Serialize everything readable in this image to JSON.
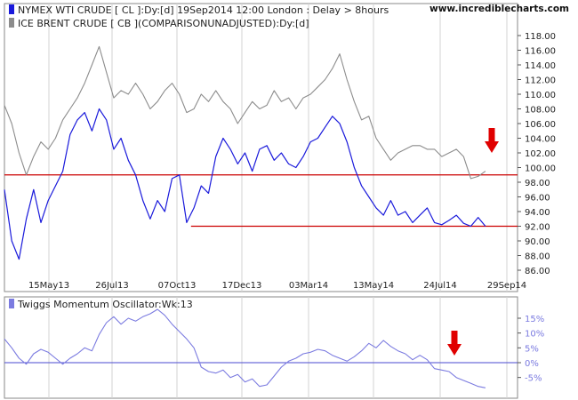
{
  "brand": "www.incrediblecharts.com",
  "colors": {
    "wti": "#1a1adb",
    "brent": "#8c8c8c",
    "support": "#cc0000",
    "osc": "#7b7be0",
    "zero": "#4a4ad0",
    "arrow": "#e00000",
    "grid": "#d3d3d3",
    "frame": "#8a8a8a"
  },
  "chart_data": [
    {
      "type": "line",
      "legend": [
        {
          "label": "NYMEX WTI CRUDE [ CL ]:Dy:[d]  19Sep2014 12:00 London : Delay > 8hours",
          "color_key": "wti"
        },
        {
          "label": "ICE BRENT CRUDE [ CB ](COMPARISONUNADJUSTED):Dy:[d]",
          "color_key": "brent"
        }
      ],
      "x_ticks": [
        "15May13",
        "26Jul13",
        "07Oct13",
        "17Dec13",
        "03Mar14",
        "13May14",
        "24Jul14",
        "29Sep14"
      ],
      "y_ticks": [
        "86.00",
        "88.00",
        "90.00",
        "92.00",
        "94.00",
        "96.00",
        "98.00",
        "100.00",
        "102.00",
        "104.00",
        "106.00",
        "108.00",
        "110.00",
        "112.00",
        "114.00",
        "116.00",
        "118.00"
      ],
      "ylim": [
        84.4,
        119.8
      ],
      "x_index_range": [
        0,
        352
      ],
      "horizontal_lines": [
        {
          "value": 99.0,
          "x_from": 0,
          "x_to": 352
        },
        {
          "value": 92.0,
          "x_from": 128,
          "x_to": 352
        }
      ],
      "annotation": "down-arrow at 26Sep14",
      "series": [
        {
          "color_key": "wti",
          "x": [
            0,
            5,
            10,
            15,
            20,
            25,
            30,
            35,
            40,
            45,
            50,
            55,
            60,
            65,
            70,
            75,
            80,
            85,
            90,
            95,
            100,
            105,
            110,
            115,
            120,
            125,
            130,
            135,
            140,
            145,
            150,
            155,
            160,
            165,
            170,
            175,
            180,
            185,
            190,
            195,
            200,
            205,
            210,
            215,
            220,
            225,
            230,
            235,
            240,
            245,
            250,
            255,
            260,
            265,
            270,
            275,
            280,
            285,
            290,
            295,
            300,
            305,
            310,
            315,
            320,
            325,
            330
          ],
          "values": [
            97.0,
            90.0,
            87.5,
            93.0,
            97.0,
            92.5,
            95.5,
            97.5,
            99.5,
            104.5,
            106.5,
            107.5,
            105.0,
            108.0,
            106.5,
            102.5,
            104.0,
            101.0,
            99.0,
            95.5,
            93.0,
            95.5,
            94.0,
            98.5,
            99.0,
            92.5,
            94.5,
            97.5,
            96.5,
            101.5,
            104.0,
            102.5,
            100.5,
            102.0,
            99.5,
            102.5,
            103.0,
            101.0,
            102.0,
            100.5,
            100.0,
            101.5,
            103.5,
            104.0,
            105.5,
            107.0,
            106.0,
            103.5,
            100.0,
            97.5,
            96.0,
            94.5,
            93.5,
            95.5,
            93.5,
            94.0,
            92.5,
            93.5,
            94.5,
            92.5,
            92.2,
            92.8,
            93.5,
            92.4,
            92.0,
            93.2,
            92.0
          ]
        },
        {
          "color_key": "brent",
          "x": [
            0,
            5,
            10,
            15,
            20,
            25,
            30,
            35,
            40,
            45,
            50,
            55,
            60,
            65,
            70,
            75,
            80,
            85,
            90,
            95,
            100,
            105,
            110,
            115,
            120,
            125,
            130,
            135,
            140,
            145,
            150,
            155,
            160,
            165,
            170,
            175,
            180,
            185,
            190,
            195,
            200,
            205,
            210,
            215,
            220,
            225,
            230,
            235,
            240,
            245,
            250,
            255,
            260,
            265,
            270,
            275,
            280,
            285,
            290,
            295,
            300,
            305,
            310,
            315,
            320,
            325,
            330
          ],
          "values": [
            108.5,
            106.0,
            102.0,
            99.0,
            101.5,
            103.5,
            102.5,
            104.0,
            106.5,
            108.0,
            109.5,
            111.5,
            114.0,
            116.5,
            113.0,
            109.5,
            110.5,
            110.0,
            111.5,
            110.0,
            108.0,
            109.0,
            110.5,
            111.5,
            110.0,
            107.5,
            108.0,
            110.0,
            109.0,
            110.5,
            109.0,
            108.0,
            106.0,
            107.5,
            109.0,
            108.0,
            108.5,
            110.5,
            109.0,
            109.5,
            108.0,
            109.5,
            110.0,
            111.0,
            112.0,
            113.5,
            115.5,
            112.0,
            109.0,
            106.5,
            107.0,
            104.0,
            102.5,
            101.0,
            102.0,
            102.5,
            103.0,
            103.0,
            102.5,
            102.5,
            101.5,
            102.0,
            102.5,
            101.5,
            98.5,
            98.8,
            99.5
          ]
        }
      ]
    },
    {
      "type": "line",
      "legend": [
        {
          "label": "Twiggs Momentum Oscillator:Wk:13",
          "color_key": "osc"
        }
      ],
      "y_ticks": [
        "-5%",
        "0%",
        "5%",
        "10%",
        "15%"
      ],
      "ylim": [
        -9,
        18
      ],
      "x_index_range": [
        0,
        352
      ],
      "horizontal_lines": [
        {
          "value": 0
        }
      ],
      "annotation": "down-arrow at 24Jul14",
      "series": [
        {
          "color_key": "osc",
          "x": [
            0,
            5,
            10,
            15,
            20,
            25,
            30,
            35,
            40,
            45,
            50,
            55,
            60,
            65,
            70,
            75,
            80,
            85,
            90,
            95,
            100,
            105,
            110,
            115,
            120,
            125,
            130,
            135,
            140,
            145,
            150,
            155,
            160,
            165,
            170,
            175,
            180,
            185,
            190,
            195,
            200,
            205,
            210,
            215,
            220,
            225,
            230,
            235,
            240,
            245,
            250,
            255,
            260,
            265,
            270,
            275,
            280,
            285,
            290,
            295,
            300,
            305,
            310,
            315,
            320,
            325,
            330
          ],
          "values": [
            8.0,
            5.0,
            1.5,
            -0.5,
            3.0,
            4.5,
            3.5,
            1.5,
            -0.5,
            1.5,
            3.0,
            5.0,
            4.0,
            9.5,
            13.5,
            15.5,
            13.0,
            15.0,
            14.0,
            15.5,
            16.5,
            18.0,
            16.0,
            13.0,
            10.5,
            8.0,
            5.0,
            -1.5,
            -3.0,
            -3.5,
            -2.5,
            -5.0,
            -4.0,
            -6.5,
            -5.5,
            -8.0,
            -7.5,
            -4.5,
            -1.5,
            0.5,
            1.5,
            3.0,
            3.5,
            4.5,
            4.0,
            2.5,
            1.5,
            0.5,
            2.0,
            4.0,
            6.5,
            5.0,
            7.5,
            5.5,
            4.0,
            3.0,
            1.0,
            2.5,
            1.0,
            -2.0,
            -2.5,
            -3.0,
            -5.0,
            -6.0,
            -7.0,
            -8.0,
            -8.5
          ]
        }
      ]
    }
  ]
}
